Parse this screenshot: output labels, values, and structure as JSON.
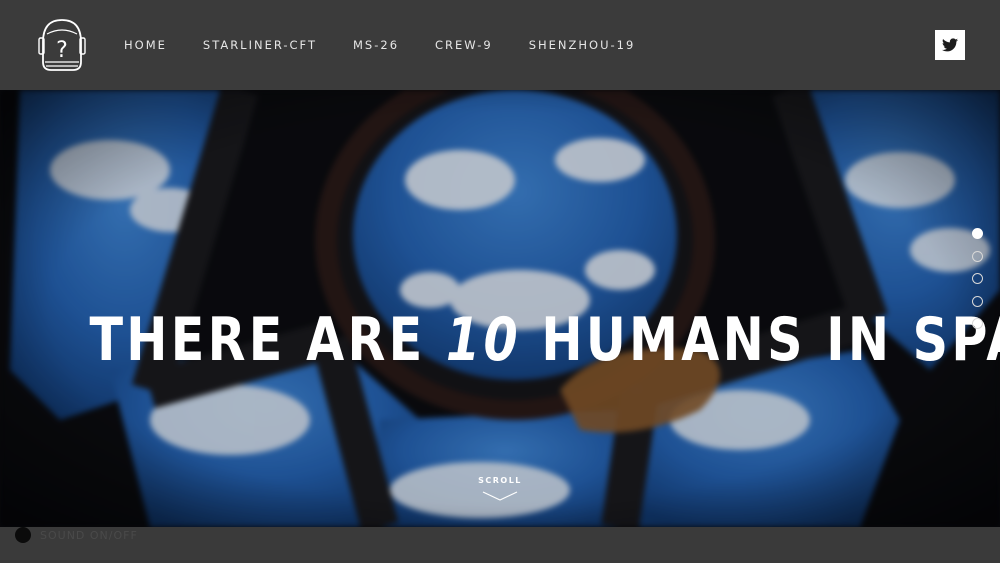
{
  "header": {
    "logo_icon": "astronaut-helmet-question-icon",
    "logo_glyph": "?",
    "nav": [
      {
        "label": "HOME"
      },
      {
        "label": "STARLINER-CFT"
      },
      {
        "label": "MS-26"
      },
      {
        "label": "CREW-9"
      },
      {
        "label": "SHENZHOU-19"
      }
    ],
    "twitter_icon": "twitter-bird-icon"
  },
  "hero": {
    "headline_pre": "THERE ARE ",
    "headline_number": "10",
    "headline_post": " HUMANS IN SPACE",
    "scroll_label": "SCROLL",
    "dots": [
      {
        "active": true
      },
      {
        "active": false
      },
      {
        "active": false
      },
      {
        "active": false
      },
      {
        "active": false
      }
    ]
  },
  "footer": {
    "sound_label": "SOUND ON/OFF"
  },
  "colors": {
    "header_bg": "#3b3b3b",
    "text": "#ffffff",
    "earth_blue": "#2a6fc4"
  }
}
